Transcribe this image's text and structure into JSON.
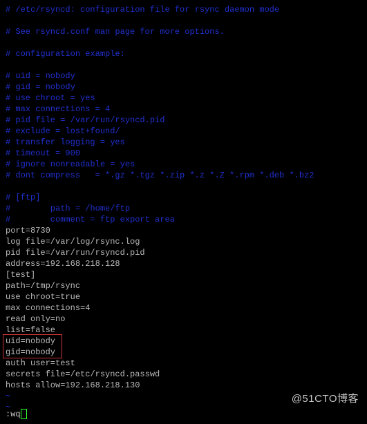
{
  "comments": {
    "l0": "# /etc/rsyncd: configuration file for rsync daemon mode",
    "l1": "",
    "l2": "# See rsyncd.conf man page for more options.",
    "l3": "",
    "l4": "# configuration example:",
    "l5": "",
    "l6": "# uid = nobody",
    "l7": "# gid = nobody",
    "l8": "# use chroot = yes",
    "l9": "# max connections = 4",
    "l10": "# pid file = /var/run/rsyncd.pid",
    "l11": "# exclude = lost+found/",
    "l12": "# transfer logging = yes",
    "l13": "# timeout = 900",
    "l14": "# ignore nonreadable = yes",
    "l15": "# dont compress   = *.gz *.tgz *.zip *.z *.Z *.rpm *.deb *.bz2",
    "l16": "",
    "l17": "# [ftp]",
    "l18": "#        path = /home/ftp",
    "l19": "#        comment = ftp export area"
  },
  "config": {
    "l0": "port=8730",
    "l1": "log file=/var/log/rsync.log",
    "l2": "pid file=/var/run/rsyncd.pid",
    "l3": "address=192.168.218.128",
    "l4": "[test]",
    "l5": "path=/tmp/rsync",
    "l6": "use chroot=true",
    "l7": "max connections=4",
    "l8": "read only=no",
    "l9": "list=false",
    "l10": "uid=nobody",
    "l11": "gid=nobody",
    "l12": "auth user=test",
    "l13": "secrets file=/etc/rsyncd.passwd",
    "l14": "hosts allow=192.168.218.130"
  },
  "tilde": "~",
  "command": ":wq",
  "watermark": "@51CTO博客"
}
